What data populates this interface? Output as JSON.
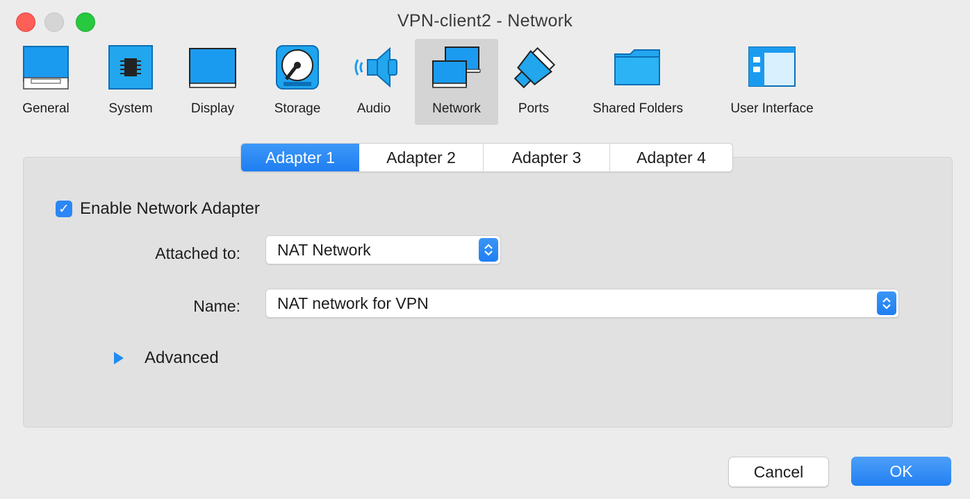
{
  "window": {
    "title": "VPN-client2 - Network"
  },
  "toolbar": {
    "items": [
      {
        "label": "General",
        "icon": "general-icon"
      },
      {
        "label": "System",
        "icon": "system-icon"
      },
      {
        "label": "Display",
        "icon": "display-icon"
      },
      {
        "label": "Storage",
        "icon": "storage-icon"
      },
      {
        "label": "Audio",
        "icon": "audio-icon"
      },
      {
        "label": "Network",
        "icon": "network-icon",
        "selected": true
      },
      {
        "label": "Ports",
        "icon": "ports-icon"
      },
      {
        "label": "Shared Folders",
        "icon": "shared-folders-icon"
      },
      {
        "label": "User Interface",
        "icon": "user-interface-icon"
      }
    ]
  },
  "tabs": [
    {
      "label": "Adapter 1",
      "active": true
    },
    {
      "label": "Adapter 2"
    },
    {
      "label": "Adapter 3"
    },
    {
      "label": "Adapter 4"
    }
  ],
  "adapter": {
    "enable_label": "Enable Network Adapter",
    "enabled": true,
    "attached_label": "Attached to:",
    "attached_value": "NAT Network",
    "name_label": "Name:",
    "name_value": "NAT network for VPN",
    "advanced_label": "Advanced"
  },
  "buttons": {
    "cancel": "Cancel",
    "ok": "OK"
  },
  "colors": {
    "accent": "#1f7ef2",
    "close": "#fe5f57",
    "maximize": "#28c840"
  }
}
